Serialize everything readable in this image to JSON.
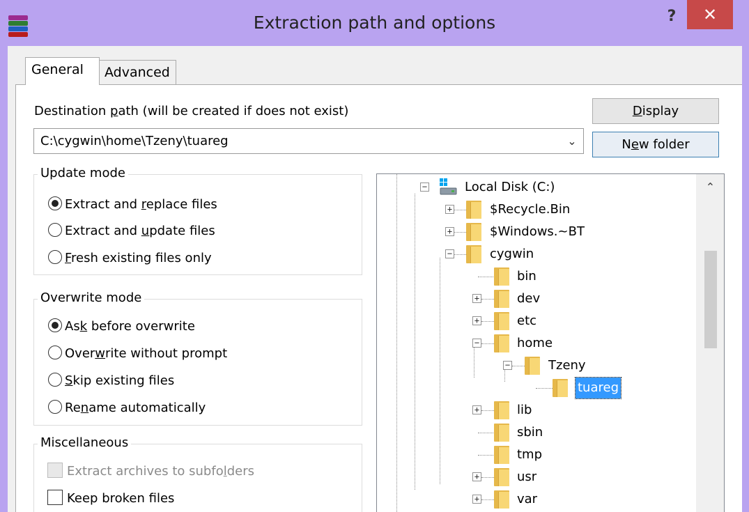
{
  "window": {
    "title": "Extraction path and options",
    "help_label": "?",
    "close_label": "✕"
  },
  "tabs": [
    {
      "label": "General",
      "active": true
    },
    {
      "label": "Advanced",
      "active": false
    }
  ],
  "destination": {
    "label": "Destination path (will be created if does not exist)",
    "value": "C:\\cygwin\\home\\Tzeny\\tuareg",
    "dropdown_icon": "⌄"
  },
  "buttons": {
    "display": "Display",
    "new_folder": "New folder"
  },
  "update_mode": {
    "legend": "Update mode",
    "options": [
      {
        "label": "Extract and replace files",
        "checked": true
      },
      {
        "label": "Extract and update files",
        "checked": false
      },
      {
        "label": "Fresh existing files only",
        "checked": false
      }
    ]
  },
  "overwrite_mode": {
    "legend": "Overwrite mode",
    "options": [
      {
        "label": "Ask before overwrite",
        "checked": true
      },
      {
        "label": "Overwrite without prompt",
        "checked": false
      },
      {
        "label": "Skip existing files",
        "checked": false
      },
      {
        "label": "Rename automatically",
        "checked": false
      }
    ]
  },
  "misc": {
    "legend": "Miscellaneous",
    "options": [
      {
        "label": "Extract archives to subfolders",
        "checked": false,
        "disabled": true
      },
      {
        "label": "Keep broken files",
        "checked": false,
        "disabled": false
      }
    ]
  },
  "tree": {
    "drive_label": "Local Disk (C:)",
    "items": [
      {
        "label": "$Recycle.Bin",
        "expander": "+"
      },
      {
        "label": "$Windows.~BT",
        "expander": "+"
      },
      {
        "label": "cygwin",
        "expander": "−"
      },
      {
        "label": "bin",
        "expander": ""
      },
      {
        "label": "dev",
        "expander": "+"
      },
      {
        "label": "etc",
        "expander": "+"
      },
      {
        "label": "home",
        "expander": "−"
      },
      {
        "label": "Tzeny",
        "expander": "−"
      },
      {
        "label": "tuareg",
        "expander": "",
        "selected": true
      },
      {
        "label": "lib",
        "expander": "+"
      },
      {
        "label": "sbin",
        "expander": ""
      },
      {
        "label": "tmp",
        "expander": ""
      },
      {
        "label": "usr",
        "expander": "+"
      },
      {
        "label": "var",
        "expander": "+"
      }
    ],
    "scroll_up_icon": "⌃"
  }
}
